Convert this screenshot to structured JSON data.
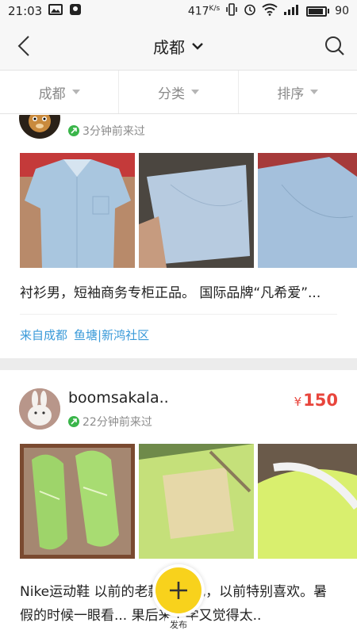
{
  "status_bar": {
    "time": "21:03",
    "speed": "417",
    "speed_unit": "K/s",
    "battery": "90",
    "battery_level": 0.9
  },
  "header": {
    "city": "成都"
  },
  "filters": [
    {
      "label": "成都"
    },
    {
      "label": "分类"
    },
    {
      "label": "排序"
    }
  ],
  "items": [
    {
      "username": "",
      "price": "",
      "visited": "3分钟前来过",
      "description": "衬衫男，短袖商务专柜正品。 国际品牌“凡希爱”...",
      "location_city": "来自成都",
      "location_area": "鱼塘|新鸿社区",
      "photo_colors": [
        "#a9c6df",
        "#b7cbe0",
        "#a4c0dc"
      ]
    },
    {
      "username": "boomsakala..",
      "price_symbol": "¥",
      "price": "150",
      "visited": "22分钟前来过",
      "description": "Nike运动鞋 以前的老款... 绿色，以前特别喜欢。暑假的时候一眼看... 果后来上学又觉得太..",
      "photo_colors": [
        "#9ed46a",
        "#c5e07a",
        "#d9ef6e"
      ]
    }
  ],
  "publish": {
    "label": "发布"
  },
  "colors": {
    "accent_yellow": "#f8d21c",
    "price_red": "#e8453c",
    "link_blue": "#3a9ad9",
    "online_green": "#3ab54a"
  }
}
